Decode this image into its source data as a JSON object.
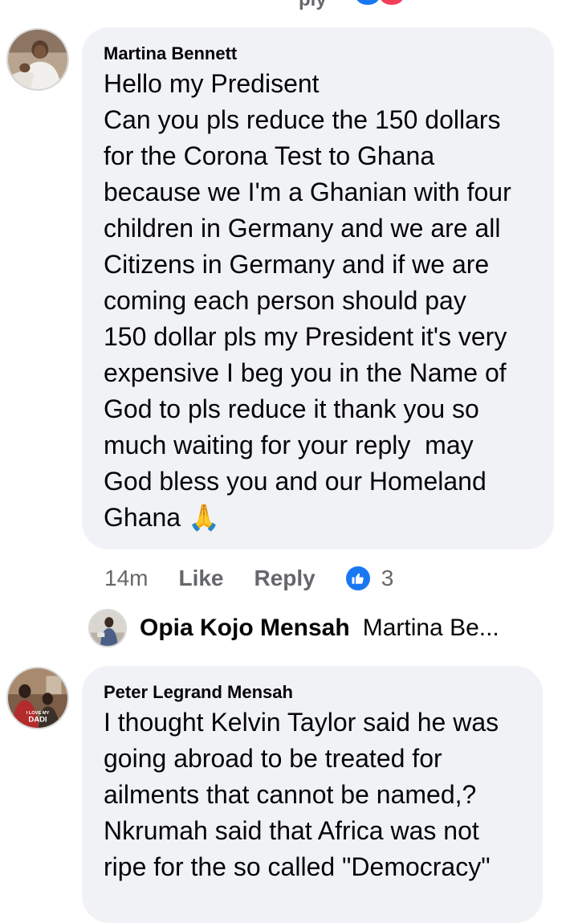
{
  "top_fragment": {
    "reply_text": "ply"
  },
  "comments": [
    {
      "author": "Martina Bennett",
      "text": "Hello my Predisent\nCan you pls reduce the 150 dollars\nfor the Corona Test to Ghana\nbecause we I'm a Ghanian with four\nchildren in Germany and we are all\nCitizens in Germany and if we are\ncoming each person should pay\n150 dollar pls my President it's very\nexpensive I beg you in the Name of\nGod to pls reduce it thank you so\nmuch waiting for your reply  may\nGod bless you and our Homeland\nGhana 🙏",
      "time": "14m",
      "like_label": "Like",
      "reply_label": "Reply",
      "reaction_count": "3",
      "reply_preview": {
        "author": "Opia Kojo Mensah",
        "snippet": "Martina Be..."
      }
    },
    {
      "author": "Peter Legrand Mensah",
      "avatar_caption": "I LOVE MY DADI",
      "text": "I thought Kelvin Taylor said he was\ngoing abroad to be treated for\nailments that cannot be named,?\nNkrumah said that Africa was not\nripe for the so called \"Democracy\""
    }
  ],
  "colors": {
    "bubble": "#f0f2f5",
    "meta_text": "#65676b",
    "like_blue": "#1877f2",
    "love_red": "#f33e58"
  }
}
